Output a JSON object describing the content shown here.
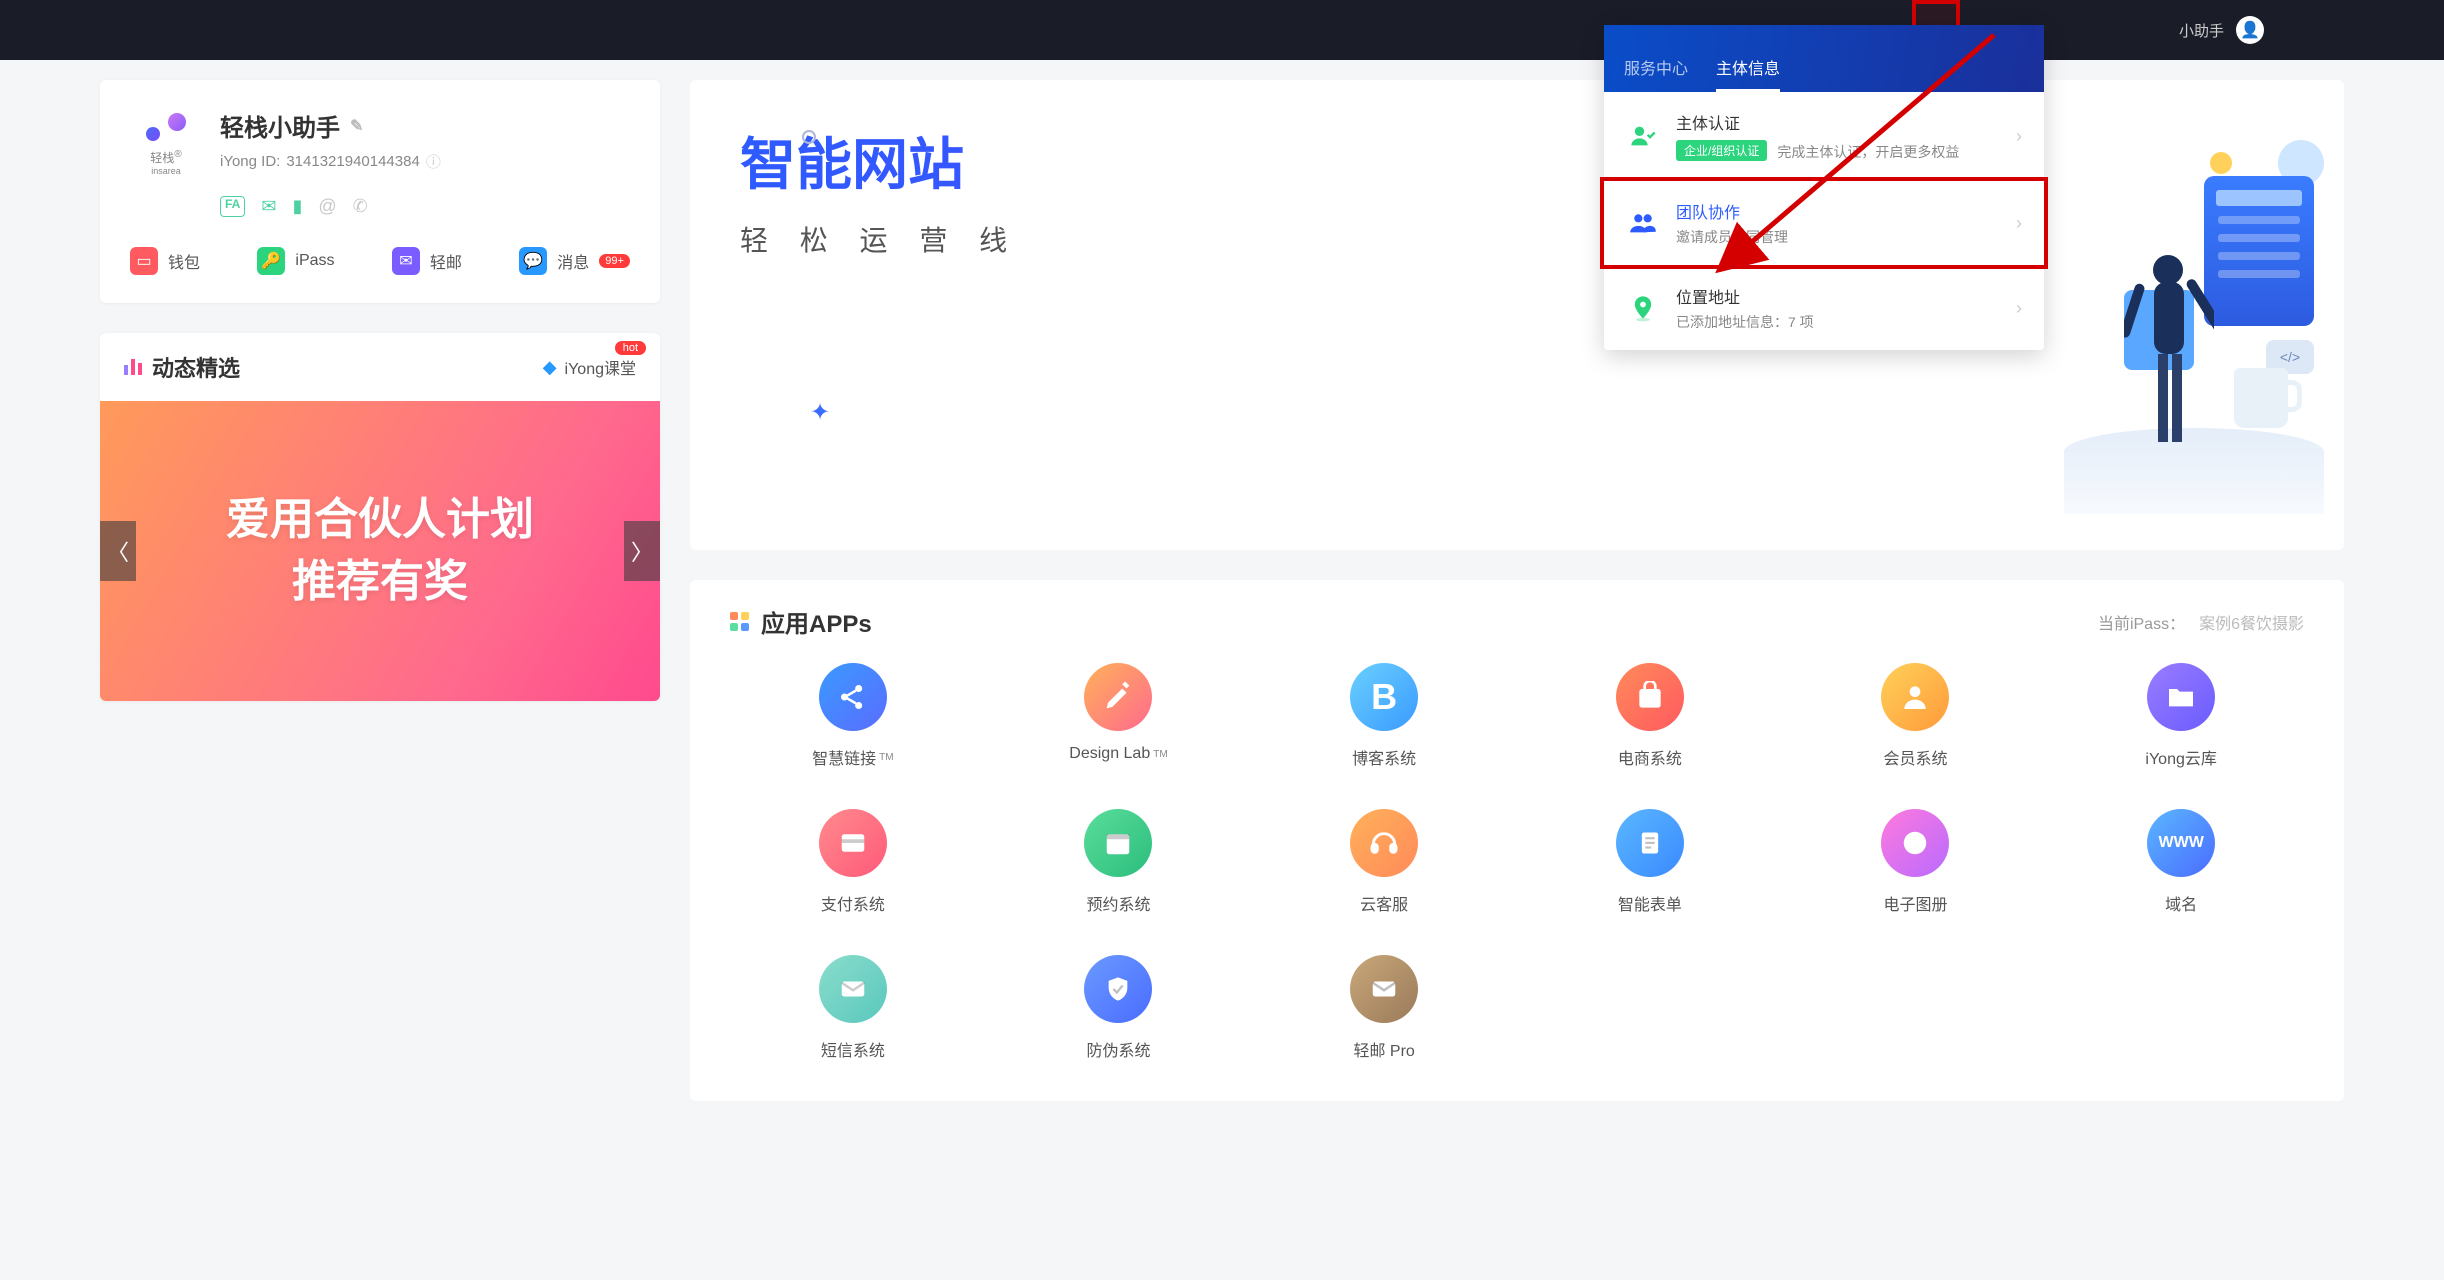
{
  "header": {
    "user_label": "小助手"
  },
  "profile": {
    "brand_sub": "轻栈",
    "brand_sub2": "insarea",
    "name": "轻栈小助手",
    "id_label": "iYong ID:",
    "id_value": "3141321940144384",
    "actions": {
      "wallet": "钱包",
      "ipass": "iPass",
      "mail": "轻邮",
      "messages": "消息",
      "msg_badge": "99+"
    }
  },
  "featured": {
    "title": "动态精选",
    "class_label": "iYong课堂",
    "hot": "hot",
    "banner_line1": "爱用合伙人计划",
    "banner_line2": "推荐有奖"
  },
  "hero": {
    "title_visible": "智能网站",
    "subtitle_visible": "轻 松 运 营 线"
  },
  "dropdown": {
    "tabs": {
      "service": "服务中心",
      "info": "主体信息"
    },
    "items": [
      {
        "title": "主体认证",
        "pill": "企业/组织认证",
        "desc": "完成主体认证，开启更多权益"
      },
      {
        "title": "团队协作",
        "desc": "邀请成员协同管理"
      },
      {
        "title": "位置地址",
        "desc": "已添加地址信息：7 项"
      }
    ]
  },
  "apps": {
    "title": "应用APPs",
    "ipass_label": "当前iPass：",
    "ipass_value": "案例6餐饮摄影",
    "items": [
      {
        "label": "智慧链接",
        "tm": true,
        "bg": "linear-gradient(135deg,#3a9aff,#5a6cff)",
        "glyph": "share"
      },
      {
        "label": "Design Lab",
        "tm": true,
        "bg": "linear-gradient(135deg,#ffb15a,#ff6a8d)",
        "glyph": "design"
      },
      {
        "label": "博客系统",
        "bg": "linear-gradient(135deg,#6ad0ff,#3a9aff)",
        "glyph": "b"
      },
      {
        "label": "电商系统",
        "bg": "linear-gradient(135deg,#ff8a5a,#ff5a5f)",
        "glyph": "cart"
      },
      {
        "label": "会员系统",
        "bg": "linear-gradient(135deg,#ffd15a,#ff9a3a)",
        "glyph": "user"
      },
      {
        "label": "iYong云库",
        "bg": "linear-gradient(135deg,#9a7cff,#6a5cff)",
        "glyph": "folder"
      },
      {
        "label": "支付系统",
        "bg": "linear-gradient(135deg,#ff8a8d,#ff5a7a)",
        "glyph": "pay"
      },
      {
        "label": "预约系统",
        "bg": "linear-gradient(135deg,#5add9a,#2bbd7d)",
        "glyph": "cal"
      },
      {
        "label": "云客服",
        "bg": "linear-gradient(135deg,#ffb15a,#ff8a5a)",
        "glyph": "headset"
      },
      {
        "label": "智能表单",
        "bg": "linear-gradient(135deg,#5ab7ff,#3a8aff)",
        "glyph": "form"
      },
      {
        "label": "电子图册",
        "bg": "linear-gradient(135deg,#ff7add,#b96aff)",
        "glyph": "book"
      },
      {
        "label": "域名",
        "bg": "linear-gradient(135deg,#5ab7ff,#4a6cff)",
        "glyph": "www"
      },
      {
        "label": "短信系统",
        "bg": "linear-gradient(135deg,#8addcc,#5ac7bd)",
        "glyph": "mail"
      },
      {
        "label": "防伪系统",
        "bg": "linear-gradient(135deg,#6a9aff,#4a6cff)",
        "glyph": "shield"
      },
      {
        "label": "轻邮 Pro",
        "bg": "linear-gradient(135deg,#c9a87a,#9a7a5a)",
        "glyph": "env"
      }
    ]
  }
}
